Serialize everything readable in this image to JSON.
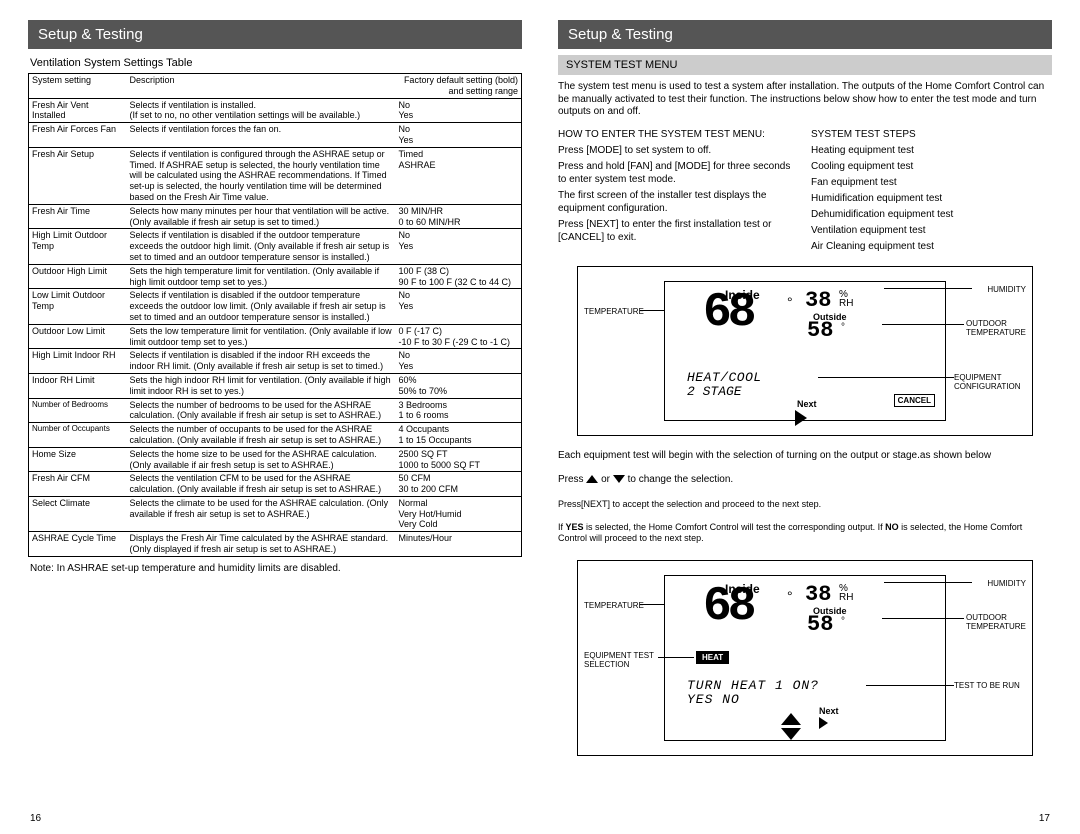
{
  "left": {
    "banner": "Setup & Testing",
    "subtitle": "Ventilation System Settings Table",
    "thead": {
      "a": "System setting",
      "b": "Description",
      "c": "Factory default setting (bold) and setting range"
    },
    "rows": [
      {
        "a": "Fresh Air Vent Installed",
        "b": "Selects if ventilation is installed.\n(If set to no, no other ventilation settings will be available.)",
        "c": "No\nYes"
      },
      {
        "a": "Fresh Air Forces Fan",
        "b": "Selects if ventilation forces the fan on.",
        "c": "No\nYes"
      },
      {
        "a": "Fresh Air Setup",
        "b": "Selects if ventilation is configured through the ASHRAE setup or Timed. If ASHRAE setup is selected, the hourly ventilation time will be calculated using the ASHRAE recommendations. If Timed set-up is selected, the hourly ventilation time will be determined based on the Fresh Air Time value.",
        "c": "Timed\nASHRAE"
      },
      {
        "a": "Fresh Air Time",
        "b": "Selects how many minutes per hour that ventilation will be active. (Only available if fresh air setup is set to timed.)",
        "c": "30 MIN/HR\n0 to 60 MIN/HR"
      },
      {
        "a": "High Limit Outdoor Temp",
        "b": "Selects if ventilation is disabled if the outdoor temperature exceeds the outdoor high limit. (Only available if fresh air setup is set to timed and an outdoor temperature sensor is installed.)",
        "c": "No\nYes"
      },
      {
        "a": "Outdoor High Limit",
        "b": "Sets the high temperature limit for ventilation. (Only available if high limit outdoor temp set to yes.)",
        "c": "100 F (38 C)\n90 F to 100 F (32 C to 44 C)"
      },
      {
        "a": "Low Limit Outdoor Temp",
        "b": "Selects if ventilation is disabled if the outdoor temperature exceeds the outdoor low limit. (Only available if fresh air setup is set to timed and an outdoor temperature sensor is installed.)",
        "c": "No\nYes"
      },
      {
        "a": "Outdoor Low Limit",
        "b": "Sets the low temperature limit for ventilation. (Only available if low limit outdoor temp set to yes.)",
        "c": "0 F (-17 C)\n-10 F to 30 F (-29 C to -1 C)"
      },
      {
        "a": "High Limit Indoor RH",
        "b": "Selects if ventilation is disabled if the indoor RH exceeds the indoor RH limit. (Only available if fresh air setup is set to timed.)",
        "c": "No\nYes"
      },
      {
        "a": "Indoor RH Limit",
        "b": "Sets the high indoor RH limit for ventilation. (Only available if high limit indoor RH is set to yes.)",
        "c": "60%\n50% to 70%"
      },
      {
        "a": "Number of Bedrooms",
        "b": "Selects the number of bedrooms to be used for the ASHRAE calculation. (Only available if fresh air setup is set to ASHRAE.)",
        "c": "3 Bedrooms\n1 to 6 rooms"
      },
      {
        "a": "Number of Occupants",
        "b": "Selects the number of occupants to be used for the ASHRAE calculation. (Only available if fresh air setup is set to ASHRAE.)",
        "c": "4 Occupants\n1 to 15 Occupants"
      },
      {
        "a": "Home Size",
        "b": "Selects the home size to be used for the ASHRAE calculation. (Only available if air fresh setup is set to ASHRAE.)",
        "c": "2500 SQ FT\n1000 to 5000 SQ FT"
      },
      {
        "a": "Fresh Air CFM",
        "b": "Selects the ventilation CFM to be used for the ASHRAE calculation. (Only available if fresh air setup is set to ASHRAE.)",
        "c": "50 CFM\n30 to 200 CFM"
      },
      {
        "a": "Select Climate",
        "b": "Selects the climate to be used for the ASHRAE calculation. (Only available if fresh air setup is set to ASHRAE.)",
        "c": "Normal\nVery Hot/Humid\nVery Cold"
      },
      {
        "a": "ASHRAE Cycle Time",
        "b": "Displays the Fresh Air Time calculated by the ASHRAE standard. (Only displayed if fresh air setup is set to ASHRAE.)",
        "c": "Minutes/Hour"
      }
    ],
    "note": "Note: In ASHRAE set-up temperature and humidity limits are disabled.",
    "pagenum": "16"
  },
  "right": {
    "banner": "Setup & Testing",
    "box": "SYSTEM TEST MENU",
    "intro": "The system test menu is used to test a system after installation. The outputs of the Home Comfort Control can be manually activated to test their function. The instructions below show how to enter the test mode and turn outputs on and off.",
    "colL": {
      "h": "HOW TO ENTER THE SYSTEM TEST MENU:",
      "l1": "Press [MODE] to set system to off.",
      "l2": "Press and hold [FAN] and [MODE] for three seconds to enter system test mode.",
      "l3": "The first screen of the installer test displays the equipment configuration.",
      "l4": "Press [NEXT] to enter the first installation test or [CANCEL] to exit."
    },
    "colR": {
      "h": "SYSTEM TEST STEPS",
      "s1": "Heating equipment test",
      "s2": "Cooling equipment test",
      "s3": "Fan equipment test",
      "s4": "Humidification equipment test",
      "s5": "Dehumidification equipment test",
      "s6": "Ventilation equipment test",
      "s7": "Air Cleaning equipment test"
    },
    "lcd1": {
      "inside": "Inside",
      "big": "68",
      "rh": "38",
      "pct": "%",
      "rhlabel": "RH",
      "outside": "Outside",
      "t58": "58",
      "m1": "HEAT/COOL",
      "m2": "2 STAGE",
      "next": "Next",
      "cancel": "CANCEL",
      "lab_t": "TEMPERATURE",
      "lab_h": "HUMIDITY",
      "lab_ot": "OUTDOOR TEMPERATURE",
      "lab_eq": "EQUIPMENT CONFIGURATION"
    },
    "mid1": "Each equipment test will begin with the selection of turning on the output or stage.as shown below",
    "mid2a": "Press",
    "mid2b": " or ",
    "mid2c": " to change the selection.",
    "mid3a": "Press",
    "mid3b": "[NEXT]",
    "mid3c": "to accept the selection and proceed to the next step.",
    "mid4a": "If ",
    "mid4b": "YES",
    "mid4c": " is selected, the Home Comfort Control will test the corresponding output. If ",
    "mid4d": "NO",
    "mid4e": " is selected, the Home Comfort Control will proceed to the next step.",
    "lcd2": {
      "inside": "Inside",
      "big": "68",
      "rh": "38",
      "pct": "%",
      "rhlabel": "RH",
      "outside": "Outside",
      "t58": "58",
      "q": "TURN HEAT 1 ON?",
      "yn": "YES NO",
      "next": "Next",
      "heat": "HEAT",
      "lab_t": "TEMPERATURE",
      "lab_h": "HUMIDITY",
      "lab_ot": "OUTDOOR TEMPERATURE",
      "lab_sel": "EQUIPMENT TEST SELECTION",
      "lab_run": "TEST TO BE RUN"
    },
    "pagenum": "17"
  }
}
